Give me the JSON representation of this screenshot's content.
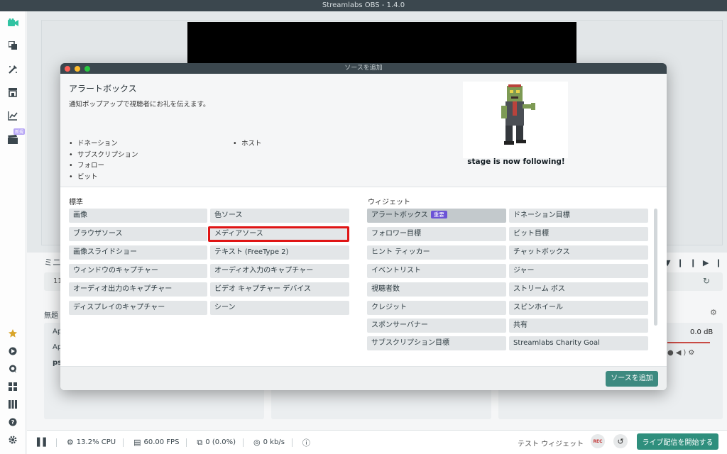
{
  "window": {
    "title": "Streamlabs OBS - 1.4.0"
  },
  "sidebar": {
    "icons": [
      "studio-icon",
      "themes-icon",
      "editor-icon",
      "store-icon",
      "stats-icon",
      "scenes-icon"
    ],
    "new_badge": "新規",
    "bottom_icons": [
      "highlighter-icon",
      "dashboard-icon",
      "chat-icon",
      "layout-icon",
      "columns-icon",
      "help-icon",
      "settings-icon"
    ]
  },
  "editor": {
    "mini_label": "ミニ",
    "mini_value": "11",
    "dock_title": "無題",
    "sources_rows": [
      "Ap",
      "Ap",
      "ps"
    ],
    "mixer_db": "0.0 dB"
  },
  "modal": {
    "window_title": "ソースを追加",
    "heading": "アラートボックス",
    "description": "通知ポップアップで視聴者にお礼を伝えます。",
    "list_left": [
      "ドネーション",
      "サブスクリプション",
      "フォロー",
      "ビット"
    ],
    "list_right": [
      "ホスト"
    ],
    "preview_caption": "stage is now following!",
    "standard_label": "標準",
    "widgets_label": "ウィジェット",
    "standard_sources": [
      "画像",
      "色ソース",
      "ブラウザソース",
      "メディアソース",
      "画像スライドショー",
      "テキスト (FreeType 2)",
      "ウィンドウのキャプチャー",
      "オーディオ入力のキャプチャー",
      "オーディオ出力のキャプチャー",
      "ビデオ キャプチャー デバイス",
      "ディスプレイのキャプチャー",
      "シーン"
    ],
    "widget_sources": [
      "アラートボックス",
      "ドネーション目標",
      "フォロワー目標",
      "ビット目標",
      "ヒント ティッカー",
      "チャットボックス",
      "イベントリスト",
      "ジャー",
      "視聴者数",
      "ストリーム ボス",
      "クレジット",
      "スピンホイール",
      "スポンサーバナー",
      "共有",
      "サブスクリプション目標",
      "Streamlabs Charity Goal"
    ],
    "important_badge": "重要",
    "add_button": "ソースを追加"
  },
  "statusbar": {
    "cpu": "13.2% CPU",
    "fps": "60.00 FPS",
    "dropped": "0 (0.0%)",
    "bandwidth": "0 kb/s",
    "test_widget": "テスト ウィジェット",
    "rec": "REC",
    "go_live": "ライブ配信を開始する"
  },
  "colors": {
    "accent": "#31c3a2",
    "primary_button": "#3d8a80",
    "go_live": "#2f8f7d",
    "highlight_box": "#e01515",
    "badge": "#6b52d6",
    "titlebar": "#3b474e"
  }
}
